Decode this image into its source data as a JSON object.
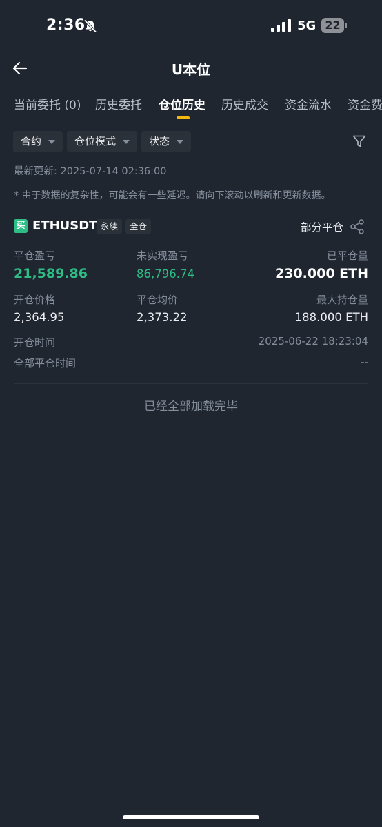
{
  "status_bar": {
    "time": "2:36",
    "network": "5G",
    "battery": "22",
    "silent_icon": "bell-slash-icon",
    "signal_icon": "signal-bars-icon"
  },
  "header": {
    "title": "U本位",
    "back_icon": "arrow-left-icon"
  },
  "tabs": [
    {
      "label": "当前委托 (0)",
      "active": false
    },
    {
      "label": "历史委托",
      "active": false
    },
    {
      "label": "仓位历史",
      "active": true
    },
    {
      "label": "历史成交",
      "active": false
    },
    {
      "label": "资金流水",
      "active": false
    },
    {
      "label": "资金费",
      "active": false
    }
  ],
  "filters": {
    "contract": "合约",
    "mode": "仓位模式",
    "status": "状态",
    "filter_icon": "funnel-icon"
  },
  "last_updated": "最新更新: 2025-07-14 02:36:00",
  "note": "* 由于数据的复杂性，可能会有一些延迟。请向下滚动以刷新和更新数据。",
  "position": {
    "side_badge": "买",
    "symbol": "ETHUSDT",
    "tags": [
      "永续",
      "全仓"
    ],
    "partial_close": "部分平仓",
    "share_icon": "share-icon",
    "fields": {
      "closed_pnl_label": "平仓盈亏",
      "closed_pnl": "21,589.86",
      "unrealized_pnl_label": "未实现盈亏",
      "unrealized_pnl": "86,796.74",
      "closed_qty_label": "已平仓量",
      "closed_qty": "230.000 ETH",
      "entry_price_label": "开仓价格",
      "entry_price": "2,364.95",
      "avg_close_label": "平仓均价",
      "avg_close": "2,373.22",
      "max_open_label": "最大持仓量",
      "max_open": "188.000 ETH",
      "open_time_label": "开仓时间",
      "open_time": "2025-06-22 18:23:04",
      "full_close_time_label": "全部平仓时间",
      "full_close_time": "--"
    }
  },
  "footer_text": "已经全部加载完毕",
  "colors": {
    "background": "#1f2630",
    "accent": "#f0b90b",
    "profit": "#2ebd85",
    "muted": "#848e9c"
  }
}
